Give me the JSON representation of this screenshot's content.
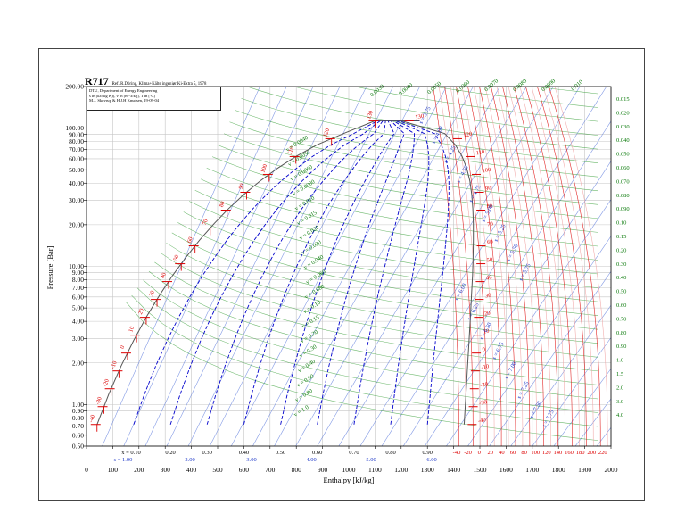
{
  "chart_data": {
    "type": "line",
    "title": "R717",
    "reference": "Ref.:R.Döring, Klima+Kälte ingeniør Ki-Extra 5, 1978",
    "info_lines": [
      "DTU, Department of Energy Engineering",
      "s in [kJ/(kg K)], v in [m^3/kg], T in [ºC]",
      "M.J. Skovrup & H.J.H Knudsen, 19-09-04"
    ],
    "xlabel": "Enthalpy [kJ/kg]",
    "ylabel": "Pressure [Bar]",
    "xlim": [
      0,
      2000
    ],
    "ylim": [
      0.5,
      200
    ],
    "yscale": "log",
    "grid": true,
    "x_ticks": [
      0,
      100,
      200,
      300,
      400,
      500,
      600,
      700,
      800,
      900,
      1000,
      1100,
      1200,
      1300,
      1400,
      1500,
      1600,
      1700,
      1800,
      1900,
      2000
    ],
    "x_tick_labels": [
      "0",
      "100",
      "200",
      "300",
      "400",
      "500",
      "600",
      "700",
      "800",
      "900",
      "1000",
      "1100",
      "1200",
      "1300",
      "1400",
      "1500",
      "1600",
      "1700",
      "1800",
      "1900",
      "2000"
    ],
    "y_ticks": [
      0.5,
      0.6,
      0.7,
      0.8,
      0.9,
      1,
      2,
      3,
      4,
      5,
      6,
      7,
      8,
      9,
      10,
      20,
      30,
      40,
      50,
      60,
      70,
      80,
      90,
      100,
      200
    ],
    "y_tick_labels": [
      "0.50",
      "0.60",
      "0.70",
      "0.80",
      "0.90",
      "1.00",
      "2.00",
      "3.00",
      "4.00",
      "5.00",
      "6.00",
      "7.00",
      "8.00",
      "9.00",
      "10.00",
      "20.00",
      "30.00",
      "40.00",
      "50.00",
      "60.00",
      "70.00",
      "80.00",
      "90.00",
      "100.00",
      "200.00"
    ],
    "saturation_dome": {
      "liquid": [
        [
          40,
          0.717
        ],
        [
          85,
          1.19
        ],
        [
          132,
          1.9
        ],
        [
          180,
          2.91
        ],
        [
          228,
          4.29
        ],
        [
          278,
          6.15
        ],
        [
          328,
          8.57
        ],
        [
          380,
          11.67
        ],
        [
          432,
          15.54
        ],
        [
          486,
          20.33
        ],
        [
          542,
          26.15
        ],
        [
          600,
          33.1
        ],
        [
          662,
          41.4
        ],
        [
          728,
          51.2
        ],
        [
          800,
          62.6
        ],
        [
          880,
          75.9
        ],
        [
          980,
          91.3
        ],
        [
          1100,
          113
        ]
      ],
      "vapor": [
        [
          1440,
          0.717
        ],
        [
          1447,
          1.19
        ],
        [
          1453,
          1.9
        ],
        [
          1459,
          2.91
        ],
        [
          1464,
          4.29
        ],
        [
          1468,
          6.15
        ],
        [
          1472,
          8.57
        ],
        [
          1474,
          11.67
        ],
        [
          1475,
          15.54
        ],
        [
          1475,
          20.33
        ],
        [
          1473,
          26.15
        ],
        [
          1469,
          33.1
        ],
        [
          1462,
          41.4
        ],
        [
          1450,
          51.2
        ],
        [
          1432,
          62.6
        ],
        [
          1406,
          75.9
        ],
        [
          1366,
          91.3
        ],
        [
          1200,
          113
        ]
      ]
    },
    "isotherms": {
      "values": [
        -40,
        -30,
        -20,
        -10,
        0,
        10,
        20,
        30,
        40,
        50,
        60,
        70,
        80,
        90,
        100,
        110,
        120,
        130
      ],
      "left_labels": [
        "-40",
        "-30",
        "-20",
        "-10",
        "0",
        "10",
        "20",
        "30",
        "40",
        "50",
        "60",
        "70",
        "80",
        "90",
        "100",
        "110",
        "120",
        "130"
      ],
      "right_labels": [
        "-40",
        "-30",
        "-20",
        "-10",
        "0",
        "10",
        "20",
        "30",
        "40",
        "50",
        "60",
        "70",
        "80",
        "90",
        "100",
        "110",
        "120",
        "130"
      ]
    },
    "bottom_temperature_labels": [
      "-40",
      "-20",
      "0",
      "20",
      "40",
      "60",
      "80",
      "100",
      "120",
      "140",
      "160",
      "180",
      "200",
      "220"
    ],
    "quality_lines": {
      "values": [
        0.1,
        0.2,
        0.3,
        0.4,
        0.5,
        0.6,
        0.7,
        0.8,
        0.9
      ],
      "labels": [
        "x = 0.10",
        "0.20",
        "0.30",
        "0.40",
        "0.50",
        "0.60",
        "0.70",
        "0.80",
        "0.90"
      ]
    },
    "entropy_lines": {
      "bottom_labels": [
        "s = 1.00",
        "2.00",
        "3.00",
        "4.00",
        "5.00",
        "6.00"
      ],
      "upper_labels": [
        "s = 3.75",
        "s = 4.00",
        "s = 4.25",
        "s = 4.50",
        "s = 4.75",
        "s = 5.00",
        "s = 5.25",
        "s = 5.50",
        "s = 5.75",
        "s = 6.00",
        "s = 6.25",
        "s = 6.50",
        "s = 6.75",
        "s = 7.00",
        "s = 7.25",
        "s = 7.50",
        "s = 7.75"
      ]
    },
    "volume_lines": {
      "dome_labels": [
        "v = 0.0040",
        "v = 0.0050",
        "v = 0.0060",
        "v = 0.0080",
        "v = 0.010",
        "v = 0.015",
        "v = 0.020",
        "v = 0.030",
        "v = 0.040",
        "v = 0.060",
        "v = 0.080",
        "v = 0.10",
        "v = 0.15",
        "v = 0.20",
        "v = 0.30",
        "v = 0.40",
        "v = 0.60",
        "v = 0.80",
        "v = 1.0"
      ],
      "right_labels": [
        "0.015",
        "0.020",
        "0.030",
        "0.040",
        "0.050",
        "0.060",
        "0.070",
        "0.080",
        "0.090",
        "0.10",
        "0.15",
        "0.20",
        "0.30",
        "0.40",
        "0.50",
        "0.60",
        "0.70",
        "0.80",
        "0.90",
        "1.0",
        "1.5",
        "2.0",
        "3.0",
        "4.0"
      ],
      "top_labels": [
        "0.0030",
        "0.0040",
        "0.0050",
        "0.0060",
        "0.0070",
        "0.0080",
        "0.0090",
        "0.010"
      ]
    },
    "colors": {
      "saturation": "#555555",
      "grid": "#c6c6c6",
      "isotherm": "#dd0000",
      "quality": "#0000cc",
      "entropy": "#5a78dc",
      "volume": "#2e9a2e",
      "volume_text": "#0a7a0a",
      "isotherm_superheat": "#f0a0a0"
    }
  }
}
